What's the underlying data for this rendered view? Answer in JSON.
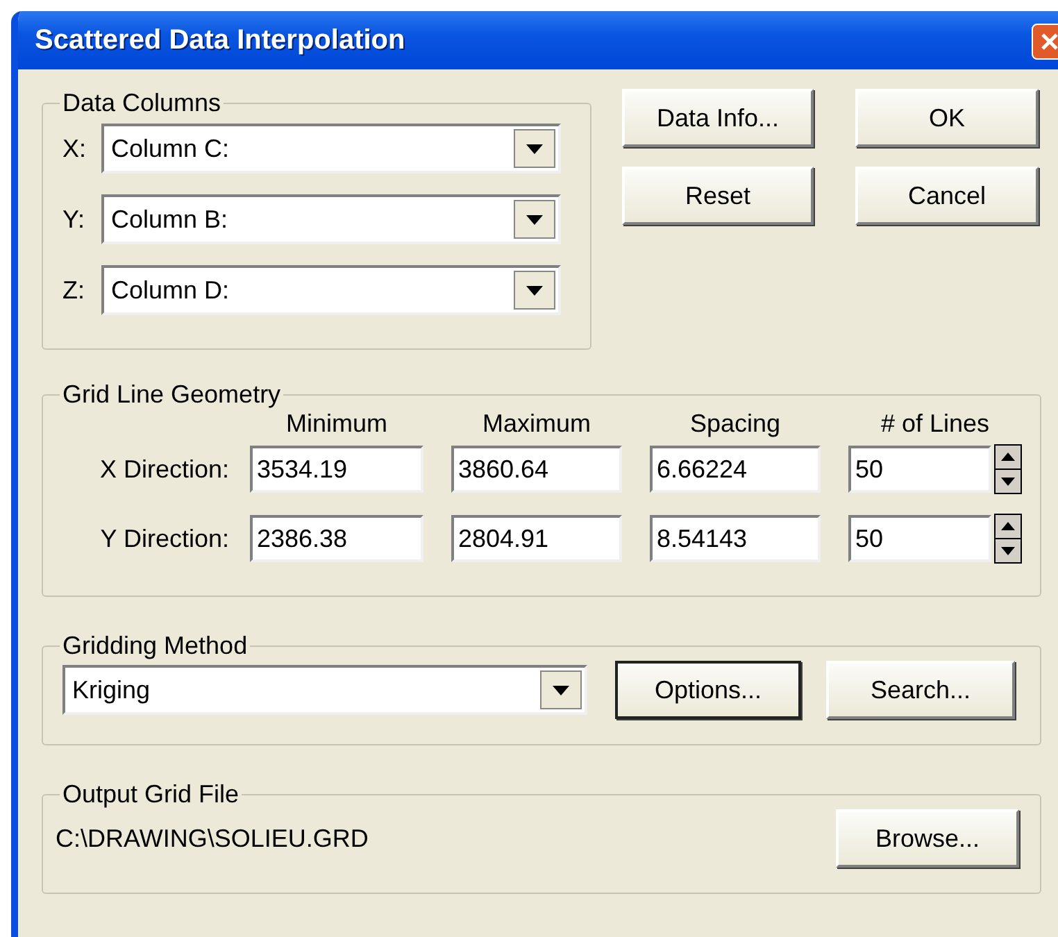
{
  "window": {
    "title": "Scattered Data Interpolation"
  },
  "data_columns": {
    "title": "Data Columns",
    "fields": [
      {
        "label": "X:",
        "value": "Column C:"
      },
      {
        "label": "Y:",
        "value": "Column B:"
      },
      {
        "label": "Z:",
        "value": "Column D:"
      }
    ]
  },
  "side_buttons": [
    {
      "label": "Data Info...",
      "focused": false
    },
    {
      "label": "OK",
      "focused": false
    },
    {
      "label": "Reset",
      "focused": false
    },
    {
      "label": "Cancel",
      "focused": false
    }
  ],
  "grid_geometry": {
    "title": "Grid Line Geometry",
    "columns": [
      "Minimum",
      "Maximum",
      "Spacing",
      "# of Lines"
    ],
    "rows": [
      {
        "label": "X Direction:",
        "values": [
          "3534.19",
          "3860.64",
          "6.66224",
          "50"
        ]
      },
      {
        "label": "Y Direction:",
        "values": [
          "2386.38",
          "2804.91",
          "8.54143",
          "50"
        ]
      }
    ]
  },
  "gridding_method": {
    "title": "Gridding Method",
    "value": "Kriging",
    "buttons": [
      {
        "label": "Options...",
        "focused": true
      },
      {
        "label": "Search...",
        "focused": false
      }
    ]
  },
  "output_grid_file": {
    "title": "Output Grid File",
    "path": "C:\\DRAWING\\SOLIEU.GRD",
    "buttons": [
      {
        "label": "Browse...",
        "focused": false
      }
    ]
  }
}
